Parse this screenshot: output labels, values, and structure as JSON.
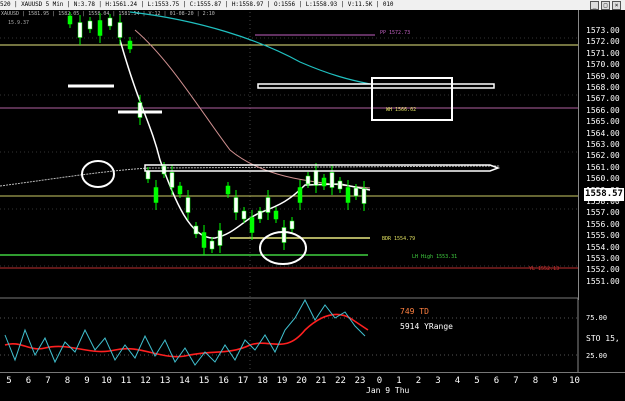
{
  "header": {
    "info": "520 | XAUUSD 5 Min | N:3.78 | H:1561.24 | L:1553.75 | C:1555.87 | H:1558.97 | O:1556 | L:1558.93 | V:11.5K | 010",
    "row2": "XAUUSD | 1581.95 | 1582.05 | 1558.04 | 1581.54 | V:12 | 01-08-20 | 2:10",
    "sub_label": "15.9.37"
  },
  "price_axis": {
    "labels": [
      "1573.00",
      "1572.00",
      "1571.00",
      "1570.00",
      "1569.00",
      "1568.00",
      "1567.00",
      "1566.00",
      "1565.00",
      "1564.00",
      "1563.00",
      "1562.00",
      "1561.00",
      "1560.00",
      "1559.00",
      "1558.00",
      "1557.00",
      "1556.00",
      "1555.00",
      "1554.00",
      "1553.00",
      "1552.00",
      "1551.00"
    ],
    "current": "1558.57"
  },
  "osc_axis": {
    "upper": "75.00",
    "mid": "STO 15,",
    "lower": "25.00"
  },
  "annotations": {
    "pp": "PP 1572.73",
    "wh": "WH 1566.02",
    "bdr": "BDR 1554.79",
    "lh": "LH High 1553.31",
    "yl": "YL 1552.13",
    "td": "749 TD",
    "yrange": "5914 YRange"
  },
  "time_axis": {
    "labels": [
      "5",
      "6",
      "7",
      "8",
      "9",
      "10",
      "11",
      "12",
      "13",
      "14",
      "15",
      "16",
      "17",
      "18",
      "19",
      "20",
      "21",
      "22",
      "23",
      "0",
      "1",
      "2",
      "3",
      "4",
      "5",
      "6",
      "7",
      "8",
      "9",
      "10"
    ],
    "day": "Jan 9 Thu"
  },
  "colors": {
    "background": "#000000",
    "candles": "#00ff00",
    "ma_white": "#ffffff",
    "ma_cyan": "#20c0c0",
    "ma_pink": "#d09090",
    "level_yellow": "#e8e880",
    "level_green": "#40d040",
    "level_red": "#c03030",
    "sto_red": "#ff2020",
    "sto_blue": "#40c0d0"
  }
}
